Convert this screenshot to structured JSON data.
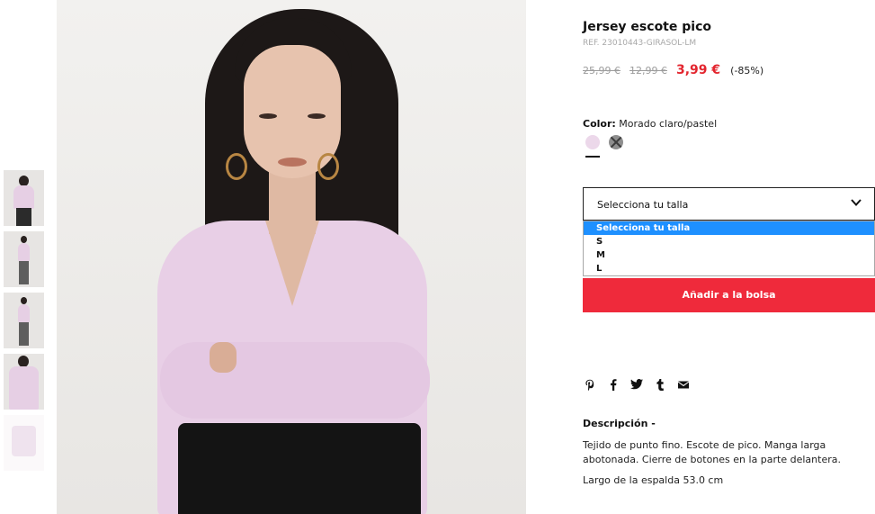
{
  "product": {
    "title": "Jersey escote pico",
    "ref": "REF. 23010443-GIRASOL-LM",
    "prices": {
      "original": "25,99 €",
      "previous": "12,99 €",
      "current": "3,99 €",
      "discount": "(-85%)"
    },
    "color": {
      "label": "Color:",
      "value": "Morado claro/pastel",
      "swatches": [
        {
          "name": "Morado claro/pastel",
          "hex": "#ecd8ea",
          "selected": true
        },
        {
          "name": "unavailable-grey",
          "hex": "#8e8e8e",
          "selected": false
        }
      ]
    },
    "size_select": {
      "label": "Selecciona tu talla",
      "options": [
        "Selecciona tu talla",
        "S",
        "M",
        "L"
      ],
      "highlighted_index": 0
    },
    "add_button": "Añadir a la bolsa",
    "share_icons": [
      "pinterest-icon",
      "facebook-icon",
      "twitter-icon",
      "tumblr-icon",
      "email-icon"
    ],
    "description": {
      "title": "Descripción -",
      "text": "Tejido de punto fino. Escote de pico. Manga larga abotonada. Cierre de botones en la parte delantera.",
      "measure": "Largo de la espalda 53.0 cm"
    }
  },
  "gallery": {
    "thumbnail_count": 5,
    "selected_thumbnail": 0
  },
  "colors": {
    "accent_red": "#ef2a3b",
    "price_red": "#e3262f",
    "option_highlight": "#1e90ff"
  }
}
